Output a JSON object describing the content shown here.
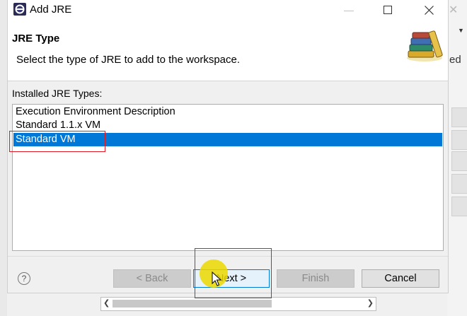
{
  "window": {
    "title": "Add JRE",
    "minimize_glyph": "—",
    "maximize_glyph": "☐",
    "close_glyph": "✕",
    "app_icon": "eclipse-icon"
  },
  "background": {
    "close_glyph": "✕",
    "partial_text": "ed"
  },
  "header": {
    "title": "JRE Type",
    "description": "Select the type of JRE to add to the workspace.",
    "icon": "books-icon"
  },
  "list": {
    "label": "Installed JRE Types:",
    "items": [
      {
        "label": "Execution Environment Description",
        "selected": false
      },
      {
        "label": "Standard 1.1.x VM",
        "selected": false
      },
      {
        "label": "Standard VM",
        "selected": true
      }
    ]
  },
  "footer": {
    "help_glyph": "?",
    "back_label": "< Back",
    "next_label": "Next >",
    "finish_label": "Finish",
    "cancel_label": "Cancel"
  },
  "colors": {
    "selection": "#0078d7",
    "highlight": "#e01b24",
    "cursor_marker": "#ecd800"
  }
}
